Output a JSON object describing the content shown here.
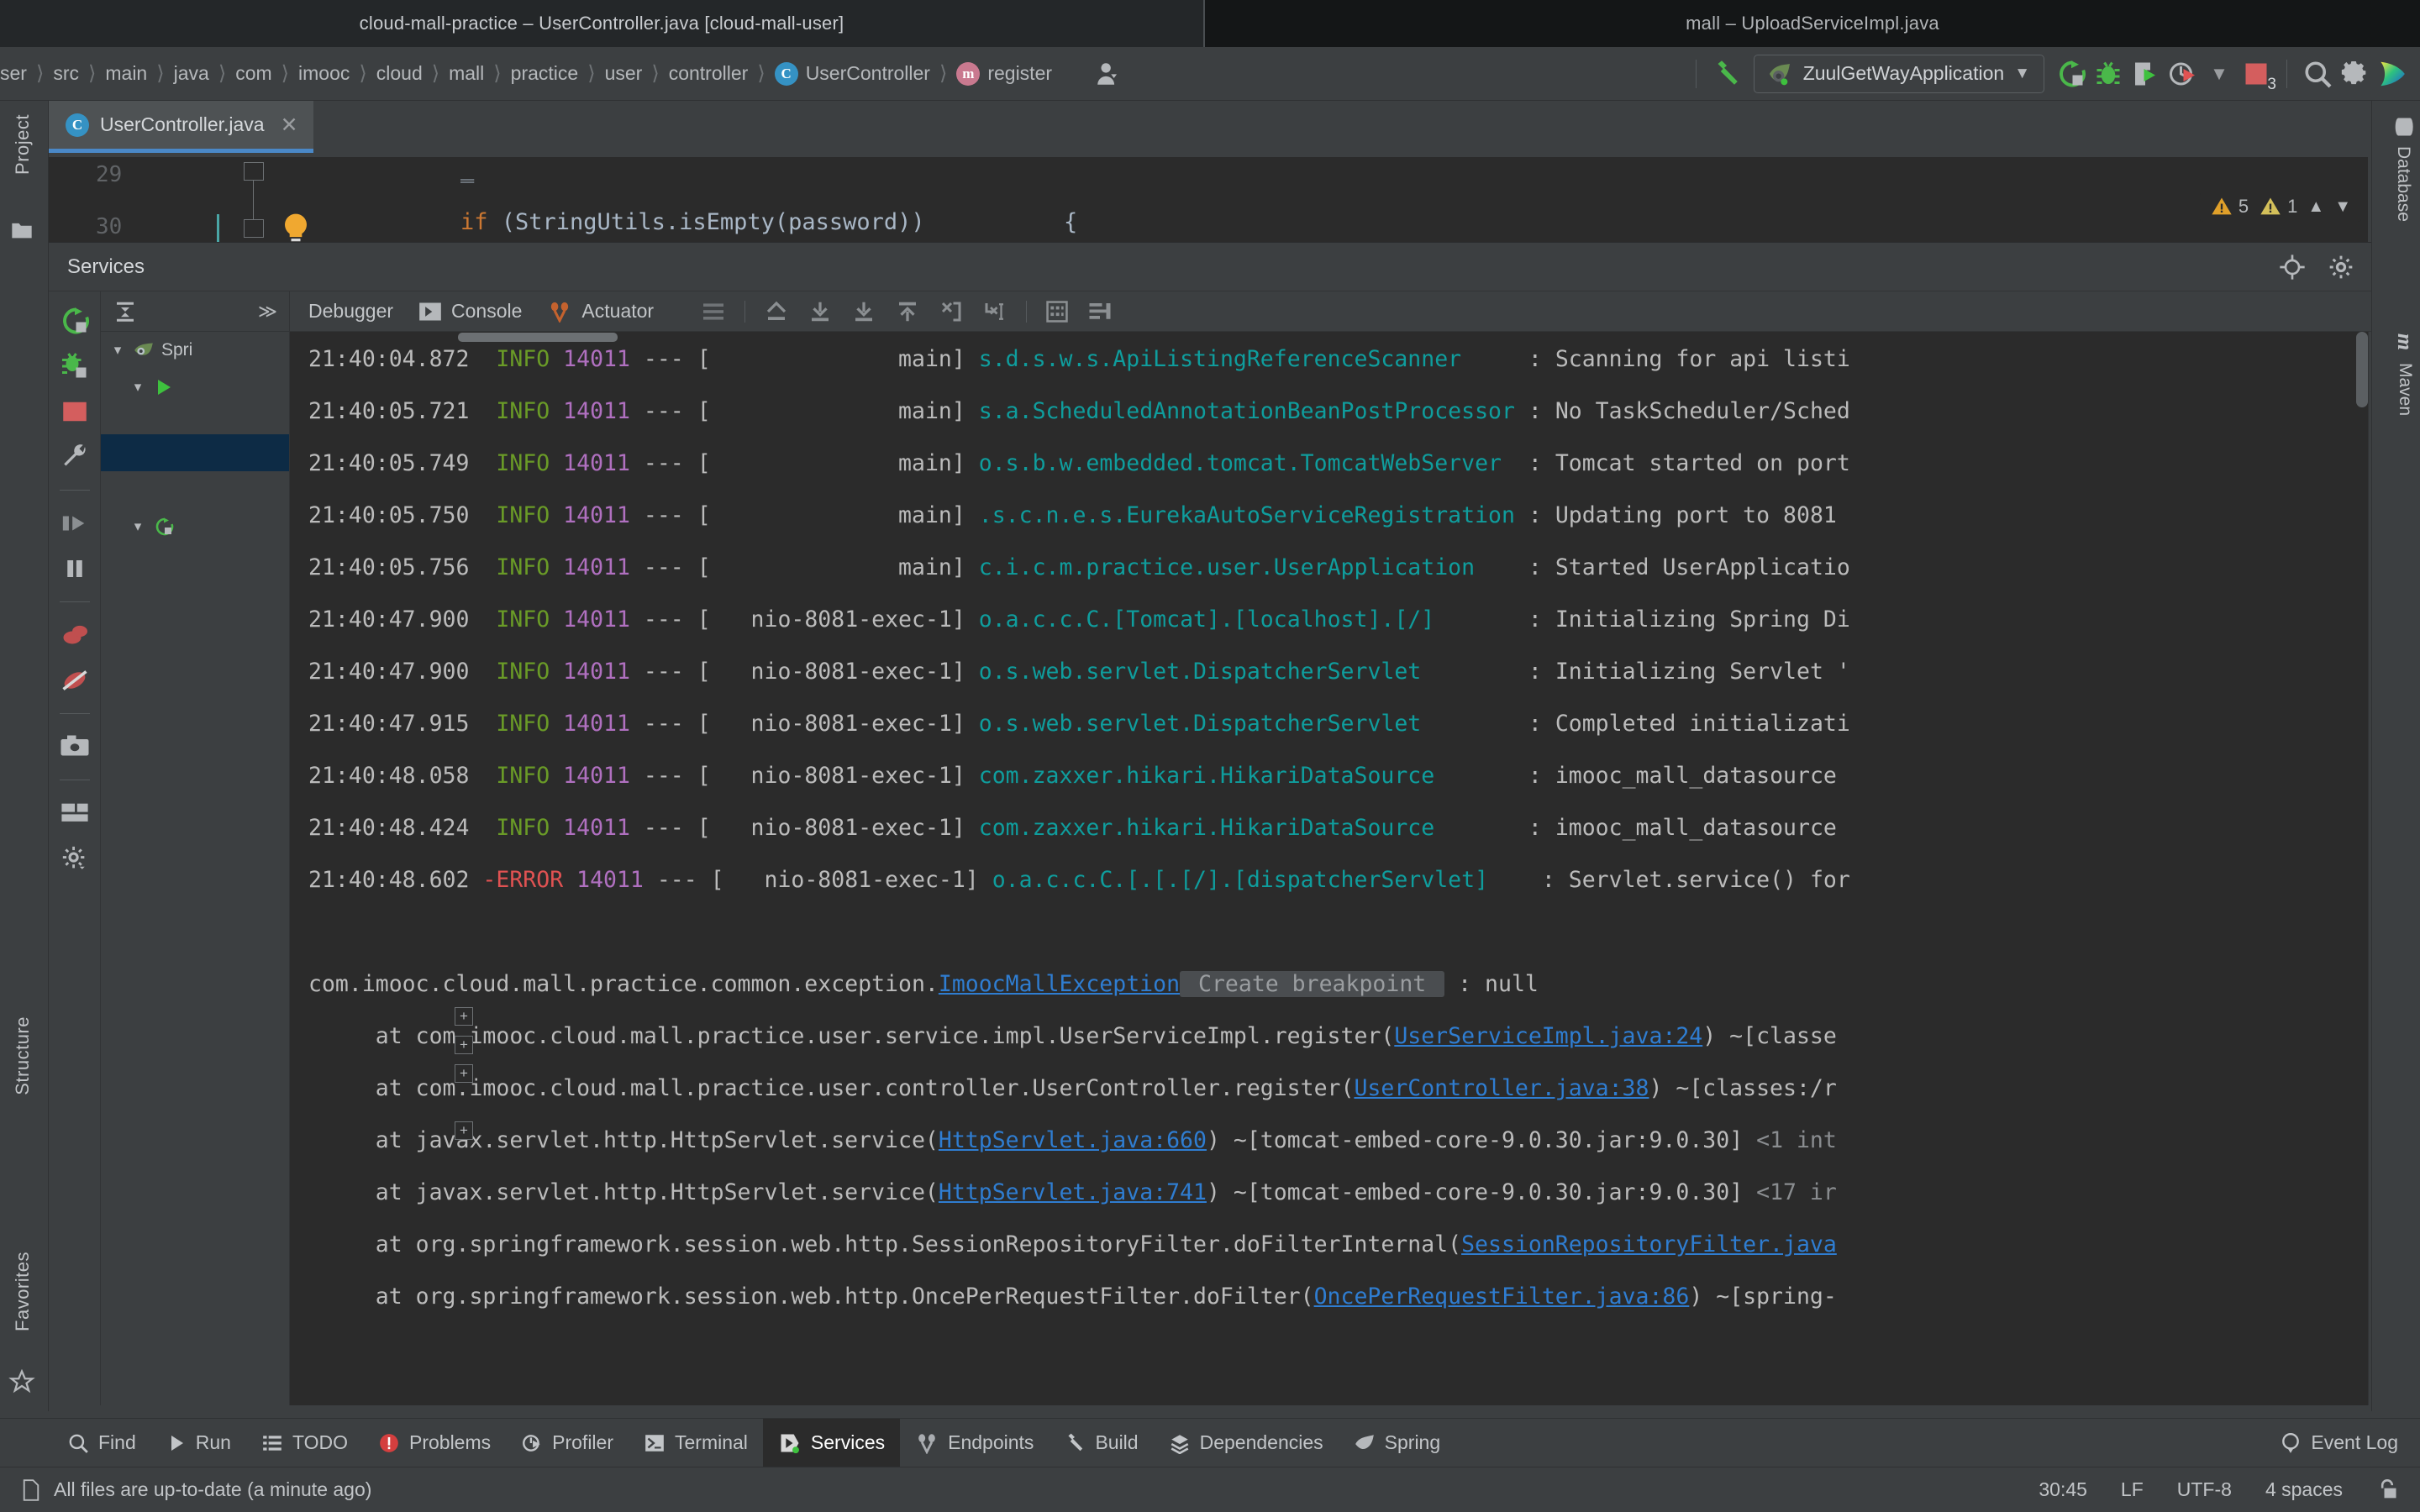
{
  "window": {
    "main_title": "cloud-mall-practice – UserController.java [cloud-mall-user]",
    "secondary_title": "mall – UploadServiceImpl.java"
  },
  "navbar": {
    "breadcrumbs": [
      {
        "label": "ser",
        "icon": null
      },
      {
        "label": "src",
        "icon": null
      },
      {
        "label": "main",
        "icon": null
      },
      {
        "label": "java",
        "icon": null
      },
      {
        "label": "com",
        "icon": null
      },
      {
        "label": "imooc",
        "icon": null
      },
      {
        "label": "cloud",
        "icon": null
      },
      {
        "label": "mall",
        "icon": null
      },
      {
        "label": "practice",
        "icon": null
      },
      {
        "label": "user",
        "icon": null
      },
      {
        "label": "controller",
        "icon": null
      },
      {
        "label": "UserController",
        "icon": "class-badge",
        "badge": "C"
      },
      {
        "label": "register",
        "icon": "method-badge",
        "badge": "m"
      }
    ],
    "run_configuration": "ZuulGetWayApplication",
    "error_count_badge": "3",
    "icons": {
      "profile": "user-profile-icon",
      "build": "build-hammer-icon",
      "rerun": "rerun-icon",
      "debug": "debug-bug-icon",
      "coverage": "run-with-coverage-icon",
      "profiler": "profiler-icon",
      "dropdown": "chevron-down-icon",
      "stop": "stop-icon",
      "search": "search-icon",
      "settings": "gear-icon",
      "plugin": "brand-logo-icon"
    }
  },
  "left_rail": {
    "items": [
      "Project",
      "Structure",
      "Favorites"
    ]
  },
  "right_rail": {
    "items": [
      "Database",
      "Maven"
    ]
  },
  "editor": {
    "tab_label": "UserController.java",
    "tab_icon": "java-class-icon",
    "close_icon": "close-icon",
    "lines": [
      {
        "num": "29",
        "text": "}"
      },
      {
        "num": "30",
        "text": "if (StringUtils.isEmpty(password)) {"
      }
    ],
    "inspections": {
      "warnings": "5",
      "weak_warnings": "1",
      "up_icon": "chevron-up-icon",
      "down_icon": "chevron-down-icon"
    }
  },
  "services": {
    "title": "Services",
    "header_icons": [
      "target-icon",
      "gear-icon",
      "minimize-icon"
    ],
    "toolbar_icons": [
      "rerun-icon",
      "rerun-debug-icon",
      "stop-icon",
      "wrench-icon",
      "step-over-icon",
      "pause-icon",
      "mute-breakpoints-icon",
      "disable-breakpoints-icon",
      "camera-icon",
      "layout-icon",
      "settings-icon"
    ],
    "tree_toolbar": {
      "collapse_icon": "collapse-all-icon",
      "more_icon": "chevron-right-right-icon"
    },
    "tree": [
      {
        "label": "Spri",
        "icon": "spring-leaf-icon",
        "expanded": true,
        "depth": 0,
        "selected": false
      },
      {
        "label": "",
        "icon": "run-play-icon",
        "expanded": true,
        "depth": 1,
        "selected": false
      },
      {
        "label": "",
        "icon": "",
        "expanded": false,
        "depth": 2,
        "selected": true
      },
      {
        "label": "",
        "icon": "rerun-icon",
        "expanded": true,
        "depth": 1,
        "selected": false
      }
    ],
    "console_tabs": [
      {
        "label": "Debugger",
        "icon": null,
        "active": false
      },
      {
        "label": "Console",
        "icon": "console-icon",
        "active": true
      },
      {
        "label": "Actuator",
        "icon": "actuator-icon",
        "active": false
      }
    ],
    "console_toolbar_icons": [
      "soft-wrap-icon",
      "step-out-icon",
      "step-into-icon",
      "force-step-into-icon",
      "step-up-icon",
      "run-to-cursor-icon",
      "drop-frame-icon",
      "evaluate-expression-icon",
      "threads-icon"
    ],
    "right_rail_icons": [
      "scroll-up-icon",
      "scroll-down-icon",
      "soft-wrap-icon",
      "scroll-to-end-icon",
      "print-icon",
      "clear-all-icon"
    ]
  },
  "console_log": {
    "lines": [
      {
        "kind": "log",
        "time": "21:40:04.872",
        "level": "INFO",
        "level_kind": "info",
        "pid": "14011",
        "thread": "main",
        "logger": "s.d.s.w.s.ApiListingReferenceScanner",
        "message": "Scanning for api listi"
      },
      {
        "kind": "log",
        "time": "21:40:05.721",
        "level": "INFO",
        "level_kind": "info",
        "pid": "14011",
        "thread": "main",
        "logger": "s.a.ScheduledAnnotationBeanPostProcessor",
        "message": "No TaskScheduler/Sched"
      },
      {
        "kind": "log",
        "time": "21:40:05.749",
        "level": "INFO",
        "level_kind": "info",
        "pid": "14011",
        "thread": "main",
        "logger": "o.s.b.w.embedded.tomcat.TomcatWebServer",
        "message": "Tomcat started on port"
      },
      {
        "kind": "log",
        "time": "21:40:05.750",
        "level": "INFO",
        "level_kind": "info",
        "pid": "14011",
        "thread": "main",
        "logger": ".s.c.n.e.s.EurekaAutoServiceRegistration",
        "message": "Updating port to 8081"
      },
      {
        "kind": "log",
        "time": "21:40:05.756",
        "level": "INFO",
        "level_kind": "info",
        "pid": "14011",
        "thread": "main",
        "logger": "c.i.c.m.practice.user.UserApplication",
        "message": "Started UserApplicatio"
      },
      {
        "kind": "log",
        "time": "21:40:47.900",
        "level": "INFO",
        "level_kind": "info",
        "pid": "14011",
        "thread": "nio-8081-exec-1",
        "logger": "o.a.c.c.C.[Tomcat].[localhost].[/]",
        "message": "Initializing Spring Di"
      },
      {
        "kind": "log",
        "time": "21:40:47.900",
        "level": "INFO",
        "level_kind": "info",
        "pid": "14011",
        "thread": "nio-8081-exec-1",
        "logger": "o.s.web.servlet.DispatcherServlet",
        "message": "Initializing Servlet '"
      },
      {
        "kind": "log",
        "time": "21:40:47.915",
        "level": "INFO",
        "level_kind": "info",
        "pid": "14011",
        "thread": "nio-8081-exec-1",
        "logger": "o.s.web.servlet.DispatcherServlet",
        "message": "Completed initializati"
      },
      {
        "kind": "log",
        "time": "21:40:48.058",
        "level": "INFO",
        "level_kind": "info",
        "pid": "14011",
        "thread": "nio-8081-exec-1",
        "logger": "com.zaxxer.hikari.HikariDataSource",
        "message": "imooc_mall_datasource"
      },
      {
        "kind": "log",
        "time": "21:40:48.424",
        "level": "INFO",
        "level_kind": "info",
        "pid": "14011",
        "thread": "nio-8081-exec-1",
        "logger": "com.zaxxer.hikari.HikariDataSource",
        "message": "imooc_mall_datasource"
      },
      {
        "kind": "log",
        "time": "21:40:48.602",
        "level": "-ERROR",
        "level_kind": "error",
        "pid": "14011",
        "thread": "nio-8081-exec-1",
        "logger": "o.a.c.c.C.[.[.[/].[dispatcherServlet]",
        "message": "Servlet.service() for"
      }
    ],
    "exception": {
      "prefix": "com.imooc.cloud.mall.practice.common.exception.",
      "type": "ImoocMallException",
      "hint": "Create breakpoint",
      "suffix": " : null"
    },
    "stack_frames": [
      {
        "fold": false,
        "text_before": "at com.imooc.cloud.mall.practice.user.service.impl.UserServiceImpl.register(",
        "link": "UserServiceImpl.java:24",
        "text_after": ") ~[classe",
        "tail": ""
      },
      {
        "fold": true,
        "text_before": "at com.imooc.cloud.mall.practice.user.controller.UserController.register(",
        "link": "UserController.java:38",
        "text_after": ") ~[classes:/r",
        "tail": ""
      },
      {
        "fold": true,
        "text_before": "at javax.servlet.http.HttpServlet.service(",
        "link": "HttpServlet.java:660",
        "text_after": ") ~[tomcat-embed-core-9.0.30.jar:9.0.30]",
        "tail": " <1 int"
      },
      {
        "fold": true,
        "text_before": "at javax.servlet.http.HttpServlet.service(",
        "link": "HttpServlet.java:741",
        "text_after": ") ~[tomcat-embed-core-9.0.30.jar:9.0.30]",
        "tail": " <17 ir"
      },
      {
        "fold": false,
        "text_before": "at org.springframework.session.web.http.SessionRepositoryFilter.doFilterInternal(",
        "link": "SessionRepositoryFilter.java",
        "text_after": "",
        "tail": ""
      },
      {
        "fold": true,
        "text_before": "at org.springframework.session.web.http.OncePerRequestFilter.doFilter(",
        "link": "OncePerRequestFilter.java:86",
        "text_after": ") ~[spring-",
        "tail": ""
      }
    ]
  },
  "bottom_tabs": [
    {
      "label": "Find",
      "icon": "search-icon",
      "active": false
    },
    {
      "label": "Run",
      "icon": "run-play-icon",
      "active": false
    },
    {
      "label": "TODO",
      "icon": "todo-list-icon",
      "active": false
    },
    {
      "label": "Problems",
      "icon": "problems-error-icon",
      "active": false
    },
    {
      "label": "Profiler",
      "icon": "profiler-icon",
      "active": false
    },
    {
      "label": "Terminal",
      "icon": "terminal-icon",
      "active": false
    },
    {
      "label": "Services",
      "icon": "services-icon",
      "active": true
    },
    {
      "label": "Endpoints",
      "icon": "endpoints-icon",
      "active": false
    },
    {
      "label": "Build",
      "icon": "build-hammer-icon",
      "active": false
    },
    {
      "label": "Dependencies",
      "icon": "dependencies-icon",
      "active": false
    },
    {
      "label": "Spring",
      "icon": "spring-leaf-icon",
      "active": false
    }
  ],
  "event_log": {
    "label": "Event Log",
    "icon": "balloon-icon"
  },
  "statusbar": {
    "message": "All files are up-to-date (a minute ago)",
    "caret_position": "30:45",
    "line_separator": "LF",
    "encoding": "UTF-8",
    "indent": "4 spaces",
    "lock_icon": "unlocked-icon",
    "left_icon": "document-icon"
  },
  "colors": {
    "accent_blue": "#4a88c7",
    "info_green": "#6a9b27",
    "error_red": "#e05252",
    "logger_cyan": "#0f9d9d",
    "pid_purple": "#b070c0",
    "link_blue": "#2f7dd1",
    "selection_navy": "#0d2b45",
    "panel_bg": "#3c3f41",
    "console_bg": "#2b2b2b"
  }
}
